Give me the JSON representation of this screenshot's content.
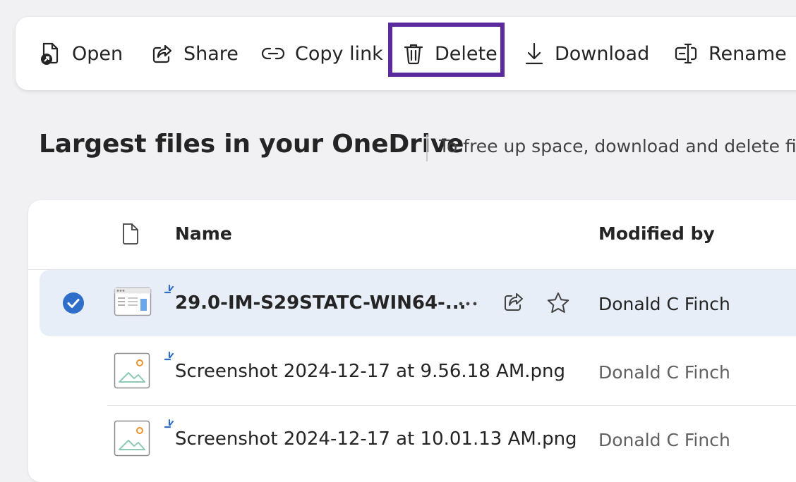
{
  "toolbar": {
    "open": "Open",
    "share": "Share",
    "copy_link": "Copy link",
    "delete": "Delete",
    "download": "Download",
    "rename": "Rename"
  },
  "page": {
    "title": "Largest files in your OneDrive",
    "subtitle": "To free up space, download and delete fil"
  },
  "table": {
    "columns": {
      "name": "Name",
      "modified_by": "Modified by"
    },
    "rows": [
      {
        "name": "29.0-IM-S29STATC-WIN64-...",
        "modified_by": "Donald C Finch",
        "selected": true,
        "icon": "installer-file-icon"
      },
      {
        "name": "Screenshot 2024-12-17 at 9.56.18 AM.png",
        "modified_by": "Donald C Finch",
        "selected": false,
        "icon": "image-file-icon"
      },
      {
        "name": "Screenshot 2024-12-17 at 10.01.13 AM.png",
        "modified_by": "Donald C Finch",
        "selected": false,
        "icon": "image-file-icon"
      }
    ]
  },
  "colors": {
    "highlight_border": "#5b2a9c",
    "selected_row": "#e8eef8",
    "check_blue": "#2f6ec9"
  }
}
